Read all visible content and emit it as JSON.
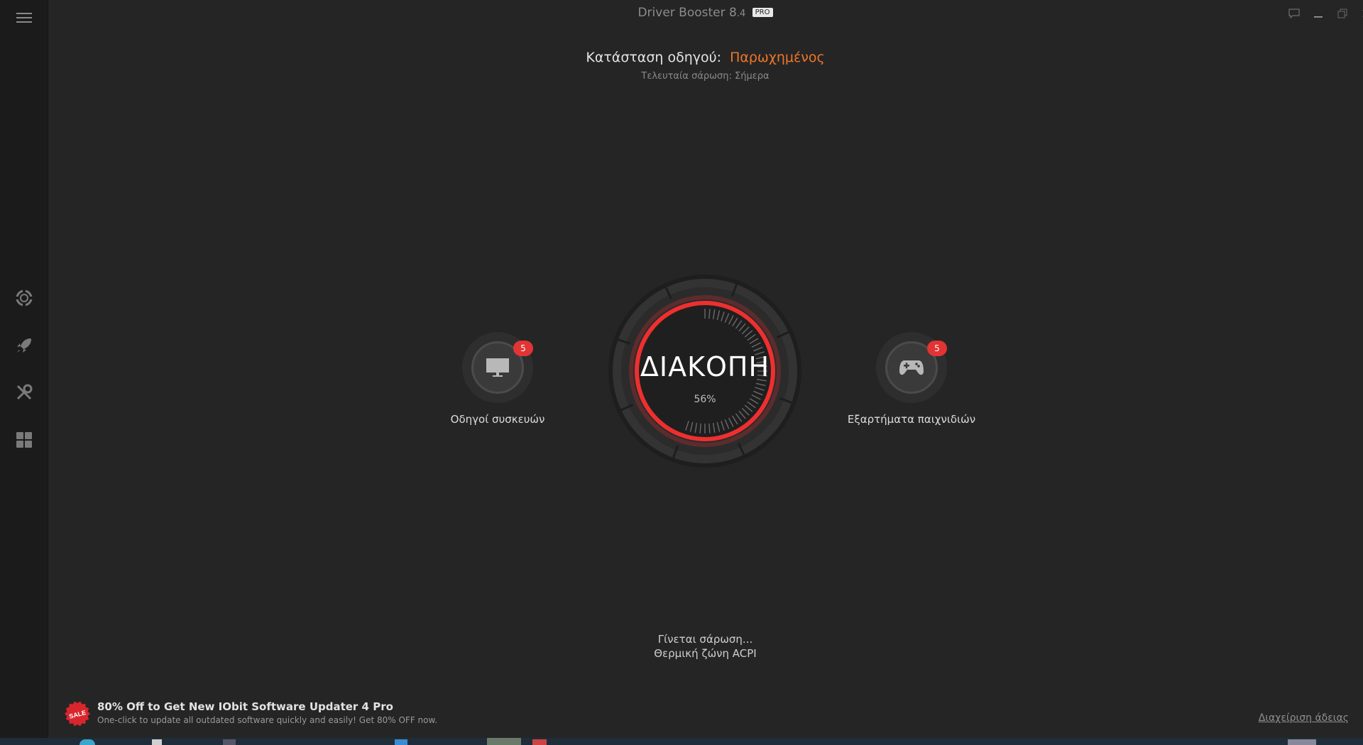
{
  "app": {
    "name": "Driver Booster 8",
    "version": ".4",
    "edition": "PRO"
  },
  "status": {
    "label": "Κατάσταση οδηγού:",
    "value": "Παρωχημένος",
    "last_scan": "Τελευταία σάρωση: Σήμερα"
  },
  "categories": [
    {
      "label": "Οδηγοί συσκευών",
      "count": "5",
      "icon": "monitor-icon"
    },
    {
      "label": "Εξαρτήματα παιχνιδιών",
      "count": "5",
      "icon": "gamepad-icon"
    }
  ],
  "dial": {
    "action": "ΔΙΑΚΟΠΗ",
    "progress_text": "56%",
    "progress": 0.56
  },
  "scan": {
    "line1": "Γίνεται σάρωση...",
    "line2": "Θερμική ζώνη ACPI"
  },
  "promo": {
    "badge": "SALE",
    "title": "80% Off to Get New IObit Software Updater 4 Pro",
    "subtitle": "One-click to update all outdated software quickly and easily! Get 80% OFF now."
  },
  "license_link": "Διαχείριση άδειας",
  "sidebar": {
    "items": [
      {
        "icon": "menu-icon"
      },
      {
        "icon": "lifebuoy-icon"
      },
      {
        "icon": "rocket-icon"
      },
      {
        "icon": "tools-icon"
      },
      {
        "icon": "apps-grid-icon"
      }
    ]
  },
  "window_controls": [
    "feedback-icon",
    "minimize-icon",
    "restore-icon",
    "close-icon"
  ],
  "colors": {
    "accent_red": "#e23434",
    "status_orange": "#f07628",
    "background": "#252525"
  }
}
